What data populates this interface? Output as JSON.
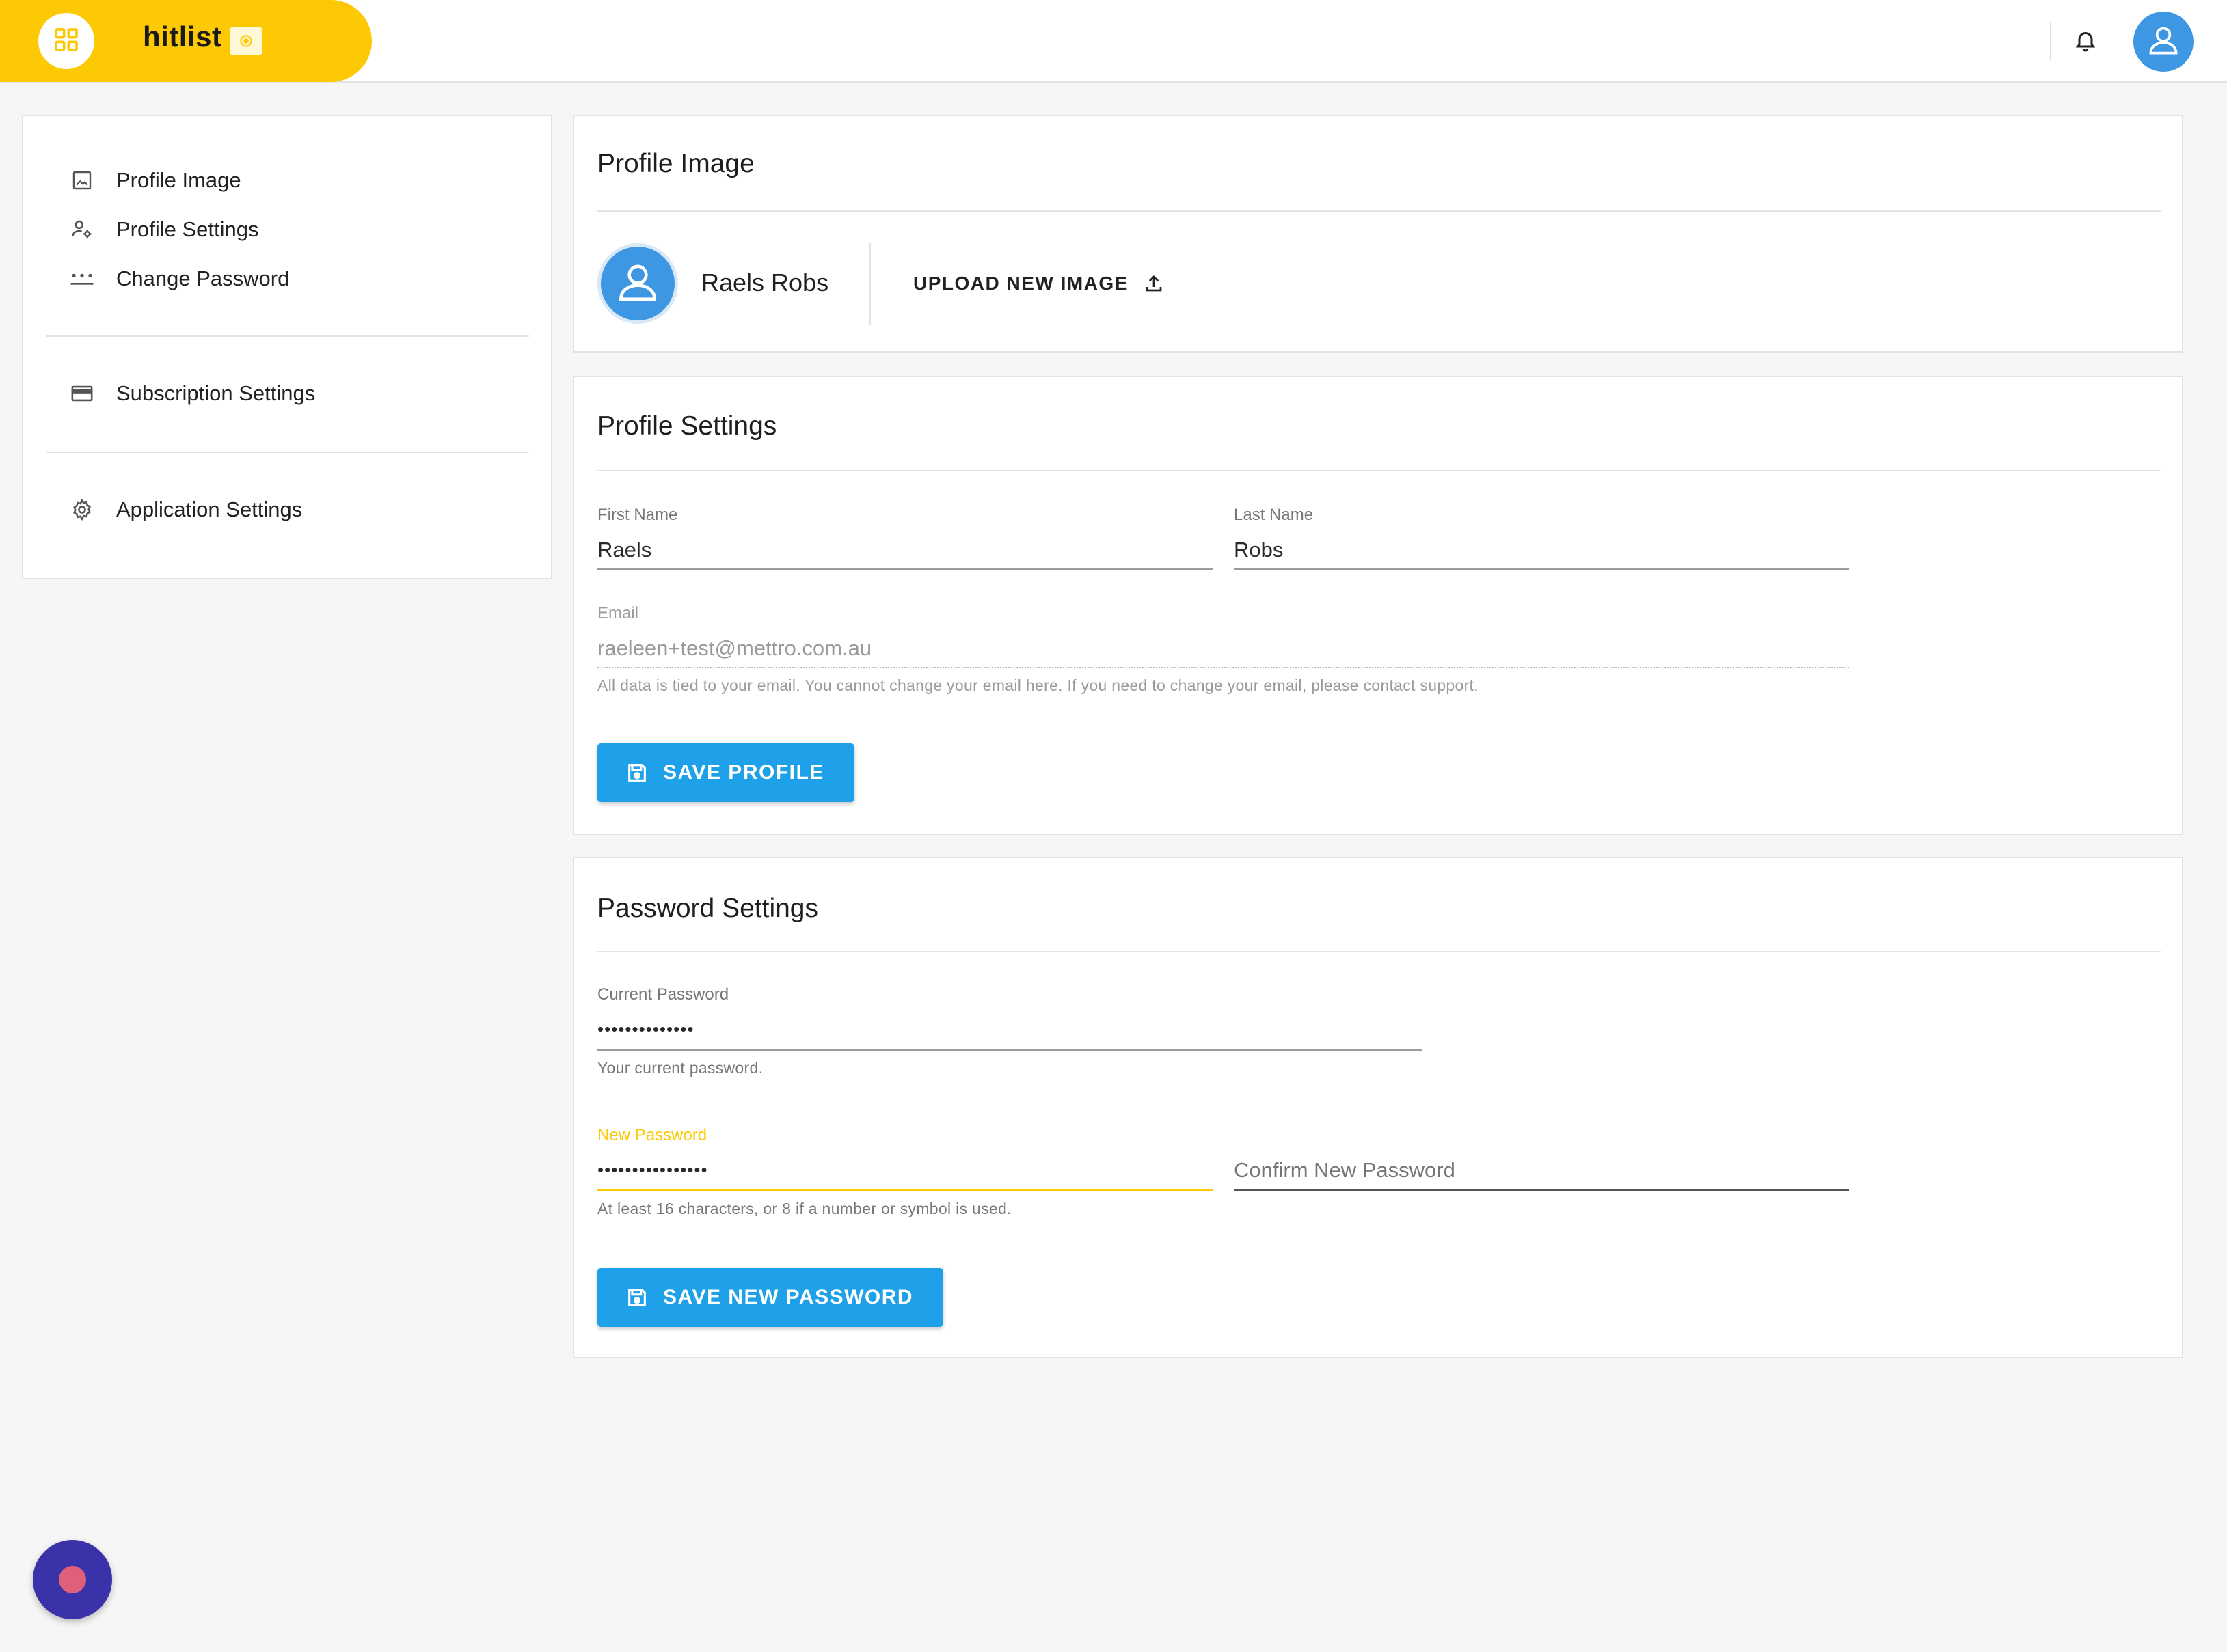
{
  "app": {
    "name": "hitlist",
    "accent": "#fdc904",
    "primary": "#1ea1e8"
  },
  "header": {
    "icons": [
      "apps-grid-icon",
      "camera-badge-icon",
      "bell-icon",
      "user-avatar-icon"
    ]
  },
  "sidebar": {
    "items": [
      {
        "label": "Profile Image",
        "icon": "image-icon"
      },
      {
        "label": "Profile Settings",
        "icon": "user-settings-icon"
      },
      {
        "label": "Change Password",
        "icon": "password-dots-icon"
      },
      {
        "label": "Subscription Settings",
        "icon": "credit-card-icon"
      },
      {
        "label": "Application Settings",
        "icon": "gear-icon"
      }
    ]
  },
  "profile_image": {
    "title": "Profile Image",
    "user_name": "Raels Robs",
    "upload_label": "UPLOAD NEW IMAGE"
  },
  "profile_settings": {
    "title": "Profile Settings",
    "first_name_label": "First Name",
    "first_name": "Raels",
    "last_name_label": "Last Name",
    "last_name": "Robs",
    "email_label": "Email",
    "email": "raeleen+test@mettro.com.au",
    "email_helper": "All data is tied to your email. You cannot change your email here. If you need to change your email, please contact support.",
    "save_label": "SAVE PROFILE"
  },
  "password_settings": {
    "title": "Password Settings",
    "current_label": "Current Password",
    "current_value": "••••••••••••••",
    "current_helper": "Your current password.",
    "new_label": "New Password",
    "new_value": "••••••••••••••••",
    "new_helper": "At least 16 characters, or 8 if a number or symbol is used.",
    "confirm_placeholder": "Confirm New Password",
    "save_label": "SAVE NEW PASSWORD"
  }
}
